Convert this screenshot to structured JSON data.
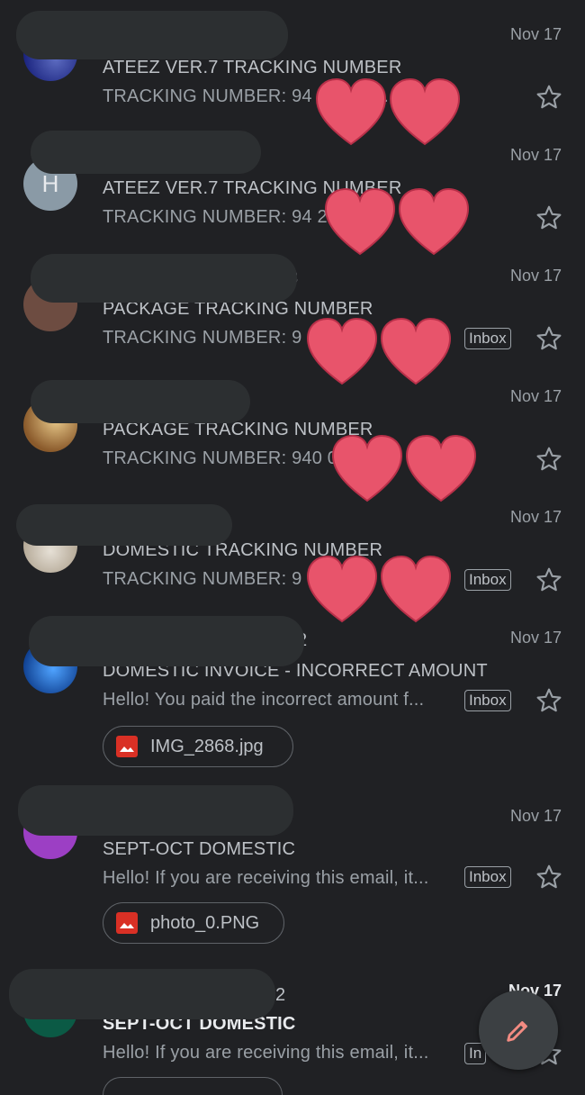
{
  "colors": {
    "background": "#202124",
    "heart": "#e8546b",
    "attachment_icon": "#d93025",
    "compose_pencil": "#f28b82"
  },
  "emails": [
    {
      "sender": "",
      "date": "Nov 17",
      "subject": "ATEEZ VER.7 TRACKING NUMBER",
      "snippet": "TRACKING NUMBER: 94         82      4153...",
      "badge": "",
      "avatar_color": "#3949ab"
    },
    {
      "sender": "",
      "date": "Nov 17",
      "subject": "ATEEZ VER.7 TRACKING NUMBER",
      "snippet": "TRACKING NUMBER: 94              2        378...",
      "badge": "",
      "avatar_color": "#8a9aa6",
      "avatar_letter": "H"
    },
    {
      "sender": "3",
      "date": "Nov 17",
      "subject": "PACKAGE TRACKING NUMBER",
      "snippet": "TRACKING NUMBER: 9         8        3...",
      "badge": "Inbox",
      "avatar_color": "#6d4c41"
    },
    {
      "sender": "",
      "date": "Nov 17",
      "subject": "PACKAGE TRACKING NUMBER",
      "snippet": "TRACKING NUMBER: 940           0          536...",
      "badge": "",
      "avatar_color": "#b07a3c"
    },
    {
      "sender": "",
      "date": "Nov 17",
      "subject": "DOMESTIC TRACKING NUMBER",
      "snippet": "TRACKING NUMBER: 9         8",
      "badge": "Inbox",
      "avatar_color": "#c9c2b8"
    },
    {
      "sender": "2",
      "date": "Nov 17",
      "subject": "DOMESTIC INVOICE - INCORRECT AMOUNT",
      "snippet": "Hello! You paid the incorrect amount f...",
      "badge": "Inbox",
      "avatar_color": "#1e63c4",
      "attachment": "IMG_2868.jpg"
    },
    {
      "sender": "",
      "date": "Nov 17",
      "subject": "SEPT-OCT DOMESTIC",
      "snippet": "Hello! If you are receiving this email, it...",
      "badge": "Inbox",
      "avatar_color": "#9c3fc4",
      "attachment": "photo_0.PNG"
    },
    {
      "sender": "2",
      "date": "Nov 17",
      "subject": "SEPT-OCT DOMESTIC",
      "snippet": "Hello! If you are receiving this email, it...",
      "badge": "In",
      "avatar_color": "#0b5a45",
      "unread": true
    }
  ],
  "icons": {
    "star": "star-icon",
    "attachment": "image-icon",
    "compose": "pencil-icon"
  }
}
